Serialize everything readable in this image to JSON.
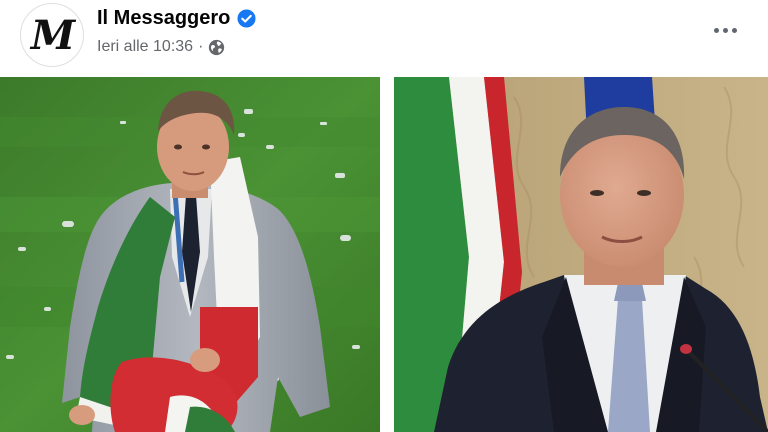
{
  "post": {
    "page_name": "Il Messaggero",
    "avatar_logo_text": "M",
    "timestamp": "Ieri alle 10:36",
    "separator": "·",
    "verified_icon": "verified-badge-icon",
    "audience_icon": "globe-icon",
    "more_icon": "more-options-icon"
  },
  "photos": [
    {
      "subject": "man-with-italian-flag-on-pitch"
    },
    {
      "subject": "man-in-suit-at-microphone"
    }
  ],
  "colors": {
    "verified": "#1877f2",
    "meta_text": "#65676b",
    "name_text": "#050505",
    "flag_green": "#2e8b3a",
    "flag_red": "#c8202a",
    "pitch_green": "#3f8a2e"
  }
}
